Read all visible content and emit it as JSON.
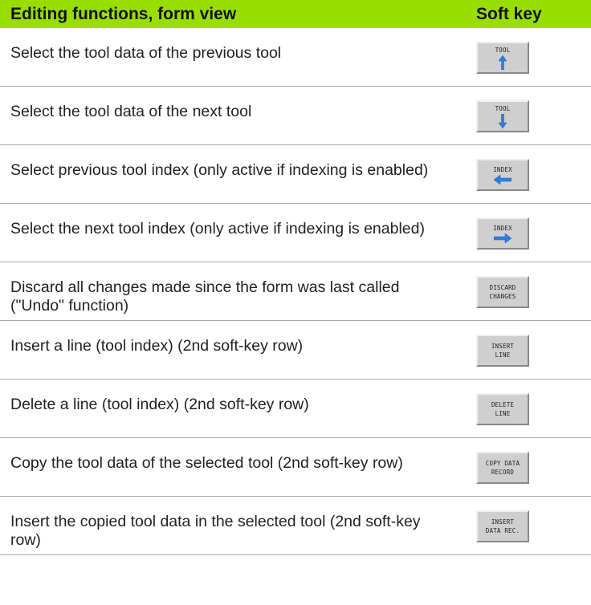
{
  "header": {
    "col1": "Editing functions, form view",
    "col2": "Soft key"
  },
  "rows": [
    {
      "text": "Select the tool data of the previous tool",
      "key": {
        "line1": "TOOL",
        "line2": "",
        "icon": "arrow-up-icon"
      }
    },
    {
      "text": "Select the tool data of the next tool",
      "key": {
        "line1": "TOOL",
        "line2": "",
        "icon": "arrow-down-icon"
      }
    },
    {
      "text": "Select previous tool index (only active if indexing is enabled)",
      "key": {
        "line1": "INDEX",
        "line2": "",
        "icon": "arrow-left-icon"
      }
    },
    {
      "text": "Select the next tool index (only active if indexing is enabled)",
      "key": {
        "line1": "INDEX",
        "line2": "",
        "icon": "arrow-right-icon"
      }
    },
    {
      "text": "Discard all changes made since the form was last called (\"Undo\" function)",
      "key": {
        "line1": "DISCARD",
        "line2": "CHANGES",
        "icon": ""
      }
    },
    {
      "text": "Insert a line (tool index) (2nd soft-key row)",
      "key": {
        "line1": "INSERT",
        "line2": "LINE",
        "icon": ""
      }
    },
    {
      "text": "Delete a line (tool index) (2nd soft-key row)",
      "key": {
        "line1": "DELETE",
        "line2": "LINE",
        "icon": ""
      }
    },
    {
      "text": "Copy the tool data of the selected tool (2nd soft-key row)",
      "key": {
        "line1": "COPY DATA",
        "line2": "RECORD",
        "icon": ""
      }
    },
    {
      "text": "Insert the copied tool data in the selected tool (2nd soft-key row)",
      "key": {
        "line1": "INSERT",
        "line2": "DATA REC.",
        "icon": ""
      }
    }
  ],
  "colors": {
    "header_bg": "#99dd00",
    "arrow_blue": "#2b7fe0",
    "key_bg": "#cfcfcf"
  }
}
